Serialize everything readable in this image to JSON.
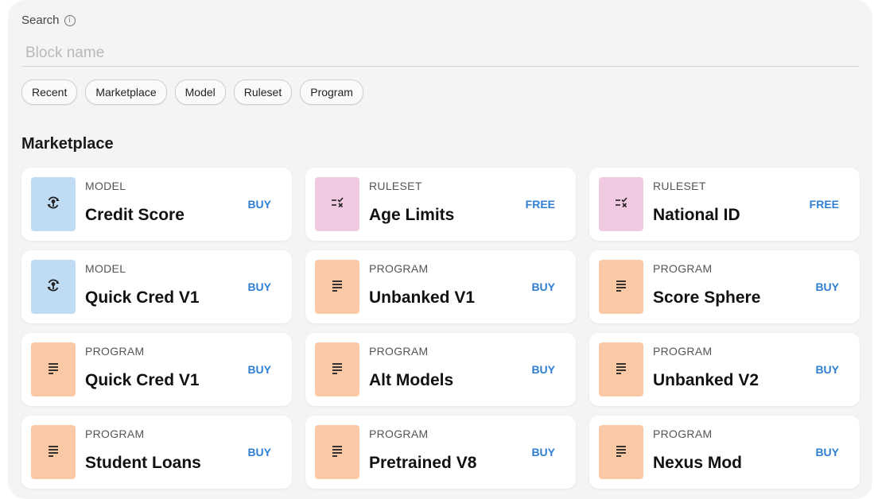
{
  "search": {
    "label": "Search",
    "info_glyph": "i",
    "placeholder": "Block name",
    "value": ""
  },
  "filters": [
    "Recent",
    "Marketplace",
    "Model",
    "Ruleset",
    "Program"
  ],
  "section": {
    "title": "Marketplace"
  },
  "colors": {
    "model": "#c0dcf5",
    "ruleset": "#f2c9e3",
    "program": "#fcc9a7",
    "action": "#2f7fd4"
  },
  "cards": [
    {
      "kind": "MODEL",
      "name": "Credit Score",
      "action": "BUY",
      "type": "model",
      "icon": "model-icon"
    },
    {
      "kind": "RULESET",
      "name": "Age Limits",
      "action": "FREE",
      "type": "ruleset",
      "icon": "ruleset-icon"
    },
    {
      "kind": "RULESET",
      "name": "National ID",
      "action": "FREE",
      "type": "ruleset",
      "icon": "ruleset-icon"
    },
    {
      "kind": "MODEL",
      "name": "Quick Cred V1",
      "action": "BUY",
      "type": "model",
      "icon": "model-icon"
    },
    {
      "kind": "PROGRAM",
      "name": "Unbanked V1",
      "action": "BUY",
      "type": "program",
      "icon": "program-icon"
    },
    {
      "kind": "PROGRAM",
      "name": "Score Sphere",
      "action": "BUY",
      "type": "program",
      "icon": "program-icon"
    },
    {
      "kind": "PROGRAM",
      "name": "Quick Cred V1",
      "action": "BUY",
      "type": "program",
      "icon": "program-icon"
    },
    {
      "kind": "PROGRAM",
      "name": "Alt Models",
      "action": "BUY",
      "type": "program",
      "icon": "program-icon"
    },
    {
      "kind": "PROGRAM",
      "name": "Unbanked V2",
      "action": "BUY",
      "type": "program",
      "icon": "program-icon"
    },
    {
      "kind": "PROGRAM",
      "name": "Student Loans",
      "action": "BUY",
      "type": "program",
      "icon": "program-icon"
    },
    {
      "kind": "PROGRAM",
      "name": "Pretrained V8",
      "action": "BUY",
      "type": "program",
      "icon": "program-icon"
    },
    {
      "kind": "PROGRAM",
      "name": "Nexus Mod",
      "action": "BUY",
      "type": "program",
      "icon": "program-icon"
    }
  ]
}
